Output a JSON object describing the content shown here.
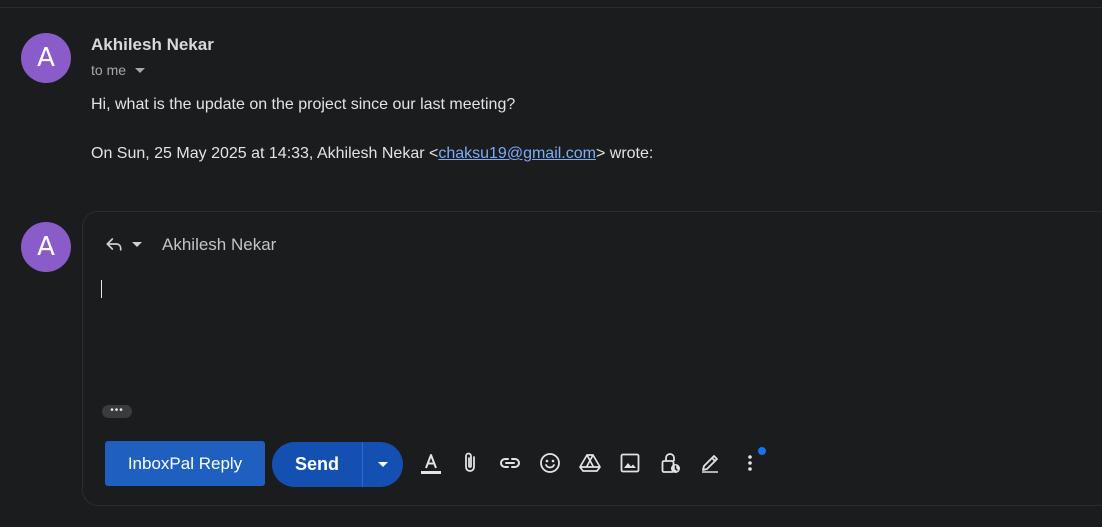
{
  "message": {
    "avatar_letter": "A",
    "sender_name": "Akhilesh Nekar",
    "recipient_summary": "to me",
    "body": "Hi, what is the update on the project since our last meeting?",
    "quote_prefix": "On Sun, 25 May 2025 at 14:33, Akhilesh Nekar <",
    "quote_email": "chaksu19@gmail.com",
    "quote_suffix": "> wrote:"
  },
  "compose": {
    "avatar_letter": "A",
    "recipient": "Akhilesh Nekar",
    "show_trimmed": "•••",
    "inboxpal_label": "InboxPal Reply",
    "send_label": "Send"
  },
  "toolbar_icons": [
    "formatting-icon",
    "attach-icon",
    "link-icon",
    "emoji-icon",
    "drive-icon",
    "photo-icon",
    "confidential-icon",
    "signature-icon",
    "more-options-icon"
  ],
  "colors": {
    "background": "#1b1c1e",
    "avatar": "#8a5cc9",
    "inboxpal_button": "#1f5fbf",
    "send_button": "#1450b2",
    "link": "#7cacf8",
    "notification_dot": "#1a73e8"
  }
}
